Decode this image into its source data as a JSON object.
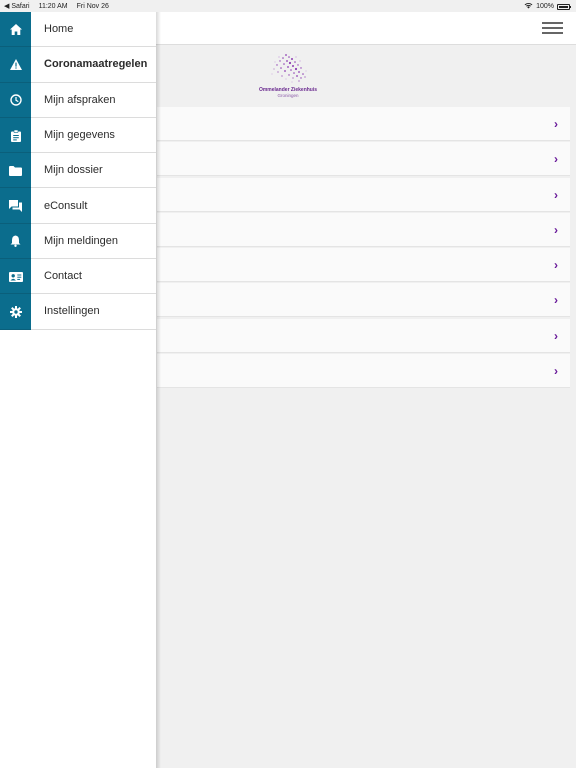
{
  "statusbar": {
    "back_app": "◀ Safari",
    "time": "11:20 AM",
    "date": "Fri Nov 26",
    "battery": "100%",
    "battery_level": 1.0
  },
  "logo": {
    "name": "Ommelander Ziekenhuis",
    "city": "Groningen"
  },
  "menu": {
    "items": [
      {
        "label": "Home",
        "icon": "home-icon",
        "bold": false
      },
      {
        "label": "Coronamaatregelen",
        "icon": "warning-icon",
        "bold": true
      },
      {
        "label": "Mijn afspraken",
        "icon": "clock-icon",
        "bold": false
      },
      {
        "label": "Mijn gegevens",
        "icon": "clipboard-icon",
        "bold": false
      },
      {
        "label": "Mijn dossier",
        "icon": "folder-icon",
        "bold": false
      },
      {
        "label": "eConsult",
        "icon": "chat-icon",
        "bold": false
      },
      {
        "label": "Mijn meldingen",
        "icon": "bell-icon",
        "bold": false
      },
      {
        "label": "Contact",
        "icon": "contact-card-icon",
        "bold": false
      },
      {
        "label": "Instellingen",
        "icon": "gear-icon",
        "bold": false
      }
    ]
  },
  "list": {
    "chevron": "›",
    "row_count": 8
  },
  "colors": {
    "menu_icon_bg": "#0b6d8d",
    "accent": "#6a1b9a"
  }
}
